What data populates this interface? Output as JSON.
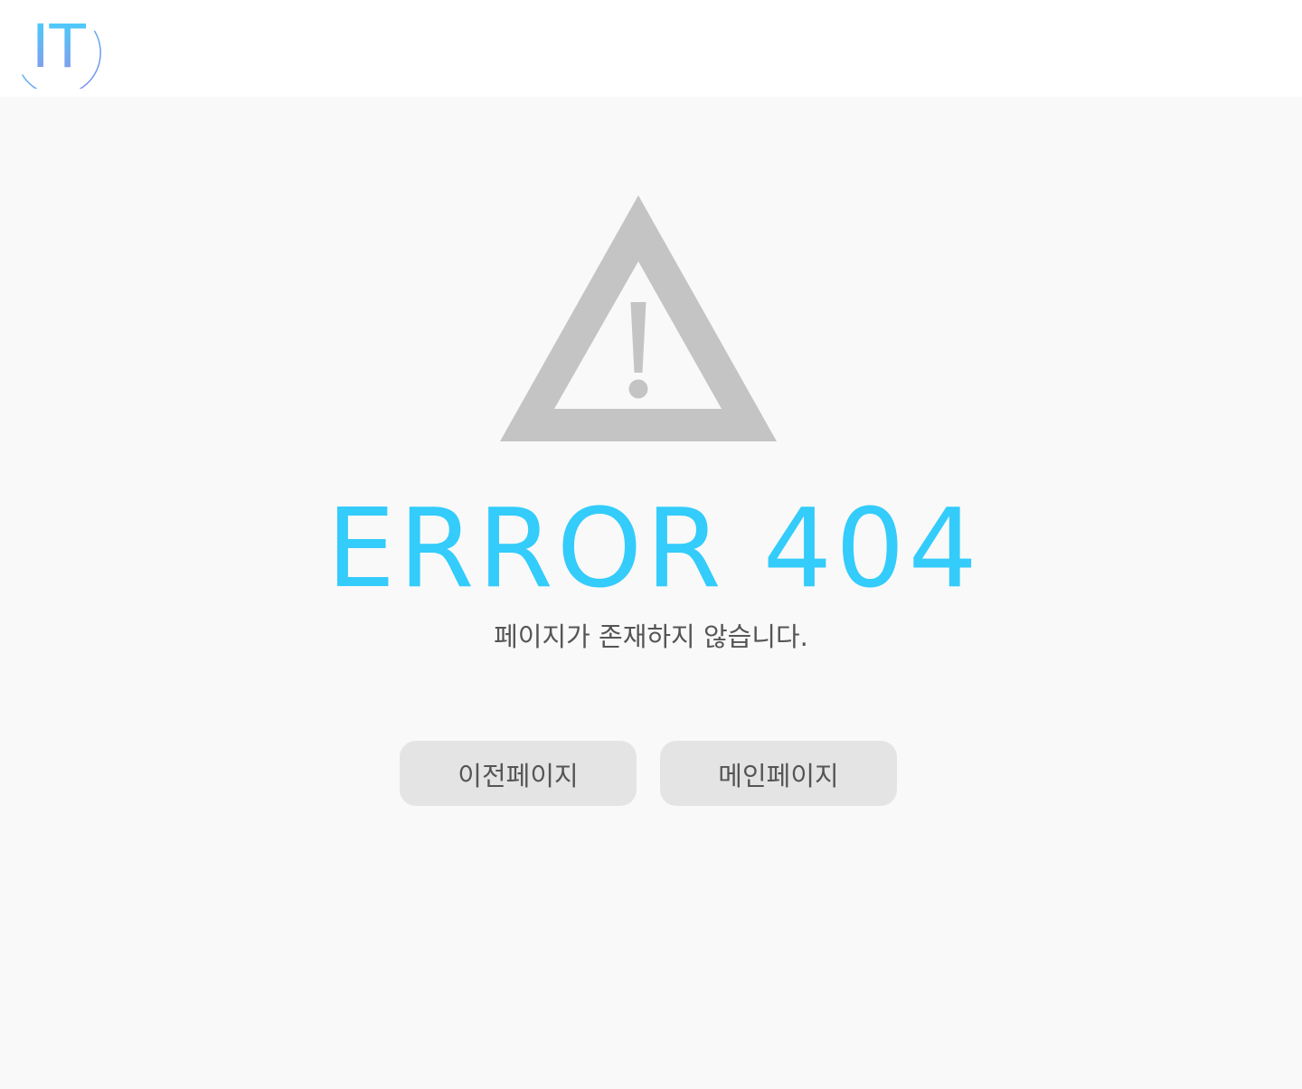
{
  "header": {
    "logo_text": "IT",
    "logo_icon": "it-logo-icon"
  },
  "error": {
    "icon": "warning-triangle-icon",
    "title": "ERROR 404",
    "message": "페이지가 존재하지 않습니다."
  },
  "actions": {
    "prev_label": "이전페이지",
    "main_label": "메인페이지"
  },
  "colors": {
    "accent": "#33ccfb",
    "icon_gray": "#c4c4c4",
    "button_bg": "#e4e4e4",
    "text_gray": "#555555",
    "page_bg": "#f9f9f9",
    "header_bg": "#ffffff"
  }
}
